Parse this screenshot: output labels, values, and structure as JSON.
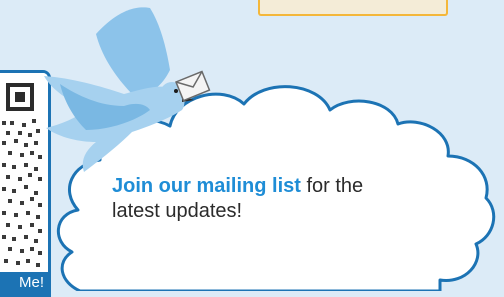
{
  "banner": {
    "headline_strong": "Join our mailing list",
    "headline_rest": " for the",
    "headline_line2": "latest updates!"
  },
  "qr": {
    "label": "Me!",
    "icon": "qr-code-icon"
  },
  "illustration": {
    "bird": "dove-icon",
    "envelope": "envelope-icon",
    "cloud": "cloud-shape"
  },
  "colors": {
    "background": "#dcebf7",
    "accent_blue": "#1c73b4",
    "headline_blue": "#1f8dd6",
    "cloud_outline": "#1c73b4",
    "bird_fill": "#8cc3ea",
    "top_bar_border": "#f4b73a"
  }
}
